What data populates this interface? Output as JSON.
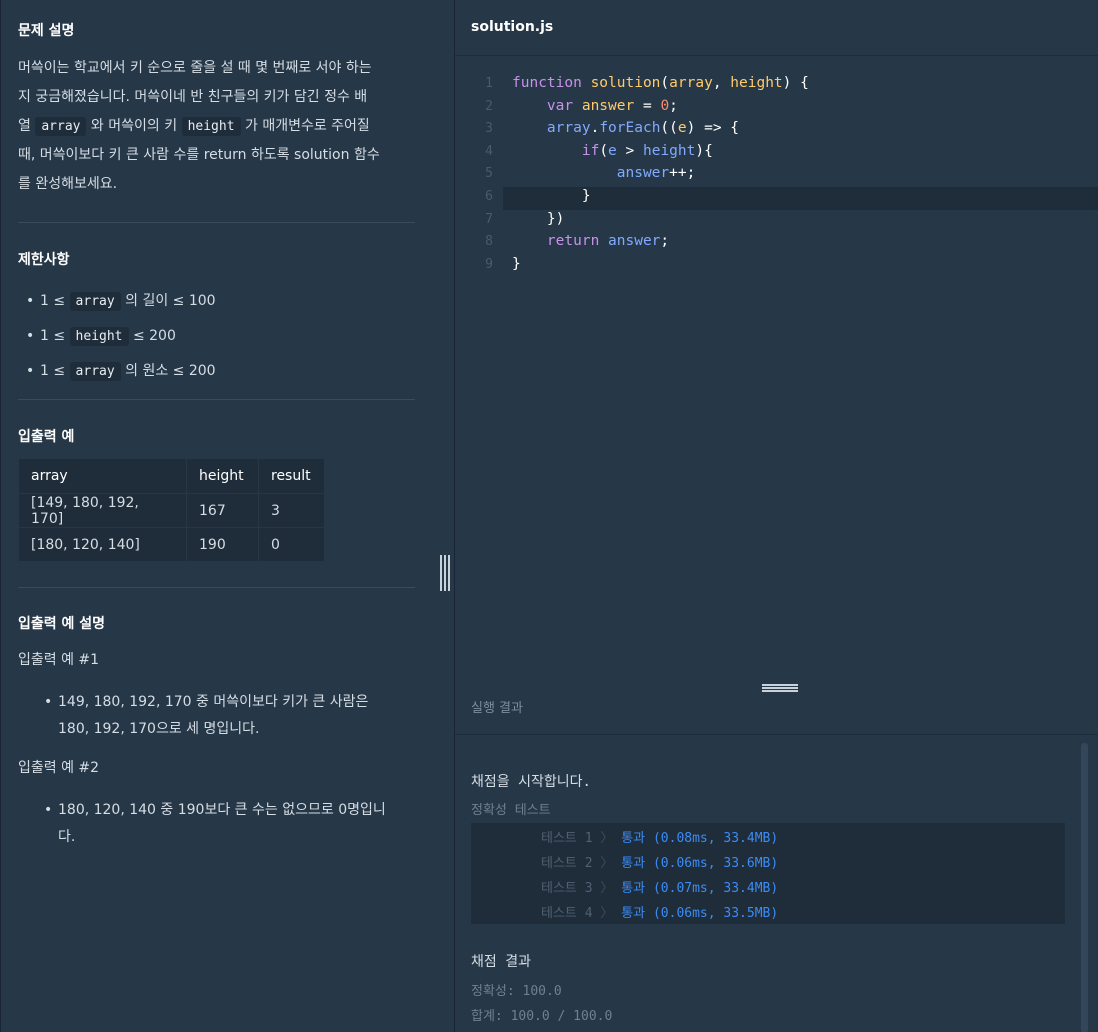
{
  "problem": {
    "section_title": "문제 설명",
    "desc_lines": [
      [
        "머쓱이는 학교에서 키 순으로 줄을 설 때 몇 번째로 서야 하는"
      ],
      [
        "지 궁금해졌습니다. 머쓱이네 반 친구들의 키가 담긴 정수 배"
      ],
      [
        "열 ",
        "array",
        " 와 머쓱이의 키 ",
        "height",
        " 가 매개변수로 주어질"
      ],
      [
        "때, 머쓱이보다 키 큰 사람 수를 return 하도록 solution 함수"
      ],
      [
        "를 완성해보세요."
      ]
    ],
    "constraints_title": "제한사항",
    "constraints": [
      {
        "pre": "1 ≤ ",
        "code": "array",
        "post": " 의 길이 ≤ 100"
      },
      {
        "pre": "1 ≤ ",
        "code": "height",
        "post": " ≤ 200"
      },
      {
        "pre": "1 ≤ ",
        "code": "array",
        "post": " 의 원소 ≤ 200"
      }
    ],
    "io_title": "입출력 예",
    "io_table": {
      "headers": [
        "array",
        "height",
        "result"
      ],
      "rows": [
        [
          "[149, 180, 192, 170]",
          "167",
          "3"
        ],
        [
          "[180, 120, 140]",
          "190",
          "0"
        ]
      ]
    },
    "explain_title": "입출력 예 설명",
    "example1_title": "입출력 예 #1",
    "example1_lines": [
      "149, 180, 192, 170 중 머쓱이보다 키가 큰 사람은",
      "180, 192, 170으로 세 명입니다."
    ],
    "example2_title": "입출력 예 #2",
    "example2_lines": [
      "180, 120, 140 중 190보다 큰 수는 없으므로 0명입니",
      "다."
    ]
  },
  "editor": {
    "file_name": "solution.js",
    "line_numbers": [
      "1",
      "2",
      "3",
      "4",
      "5",
      "6",
      "7",
      "8",
      "9"
    ],
    "lines": [
      [
        [
          "kw",
          "function "
        ],
        [
          "fn",
          "solution"
        ],
        [
          "op",
          "("
        ],
        [
          "pm",
          "array"
        ],
        [
          "op",
          ", "
        ],
        [
          "pm",
          "height"
        ],
        [
          "op",
          ") {"
        ]
      ],
      [
        [
          "op",
          "    "
        ],
        [
          "kw",
          "var "
        ],
        [
          "pm",
          "answer"
        ],
        [
          "op",
          " = "
        ],
        [
          "nm",
          "0"
        ],
        [
          "op",
          ";"
        ]
      ],
      [
        [
          "op",
          "    "
        ],
        [
          "vr",
          "array"
        ],
        [
          "op",
          "."
        ],
        [
          "vr",
          "forEach"
        ],
        [
          "op",
          "(("
        ],
        [
          "pm",
          "e"
        ],
        [
          "op",
          ") => {"
        ]
      ],
      [
        [
          "op",
          "        "
        ],
        [
          "kw",
          "if"
        ],
        [
          "op",
          "("
        ],
        [
          "vr",
          "e"
        ],
        [
          "op",
          " > "
        ],
        [
          "vr",
          "height"
        ],
        [
          "op",
          "){"
        ]
      ],
      [
        [
          "op",
          "            "
        ],
        [
          "vr",
          "answer"
        ],
        [
          "op",
          "++;"
        ]
      ],
      [
        [
          "op",
          "        }"
        ]
      ],
      [
        [
          "op",
          "    })"
        ]
      ],
      [
        [
          "op",
          "    "
        ],
        [
          "kw",
          "return "
        ],
        [
          "vr",
          "answer"
        ],
        [
          "op",
          ";"
        ]
      ],
      [
        [
          "op",
          "}"
        ]
      ]
    ]
  },
  "result": {
    "title": "실행 결과",
    "start_msg": "채점을 시작합니다.",
    "category": "정확성  테스트",
    "tests": [
      {
        "name": "테스트 1",
        "sep": "〉",
        "status": "통과 (0.08ms, 33.4MB)"
      },
      {
        "name": "테스트 2",
        "sep": "〉",
        "status": "통과 (0.06ms, 33.6MB)"
      },
      {
        "name": "테스트 3",
        "sep": "〉",
        "status": "통과 (0.07ms, 33.4MB)"
      },
      {
        "name": "테스트 4",
        "sep": "〉",
        "status": "통과 (0.06ms, 33.5MB)"
      }
    ],
    "grade_title": "채점 결과",
    "accuracy": "정확성: 100.0",
    "total": "합계: 100.0 / 100.0"
  },
  "colors": {
    "background": "#263747",
    "code_bg": "#1f2c3a",
    "pass_blue": "#3b8cf5",
    "keyword": "#c792ea",
    "function": "#ffcb6b"
  }
}
